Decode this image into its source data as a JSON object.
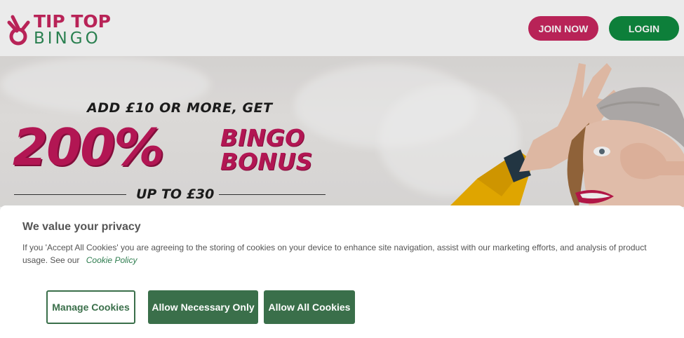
{
  "header": {
    "logo_top": "TIP TOP",
    "logo_bottom": "BINGO",
    "join_label": "JOIN NOW",
    "login_label": "LOGIN"
  },
  "hero": {
    "line1": "ADD £10 OR MORE, GET",
    "big": "200%",
    "side_line1": "BINGO",
    "side_line2": "BONUS",
    "upto": "UP TO £30"
  },
  "cookie": {
    "title": "We value your privacy",
    "text": "If you 'Accept All Cookies' you are agreeing to the storing of cookies on your device to enhance site navigation, assist with our marketing efforts, and analysis of product usage. See our",
    "link": "Cookie Policy",
    "manage_label": "Manage Cookies",
    "necessary_label": "Allow Necessary Only",
    "all_label": "Allow All Cookies"
  },
  "colors": {
    "brand_pink": "#c8265f",
    "brand_green": "#0f8a3f",
    "cookie_green": "#3a6f4a"
  }
}
